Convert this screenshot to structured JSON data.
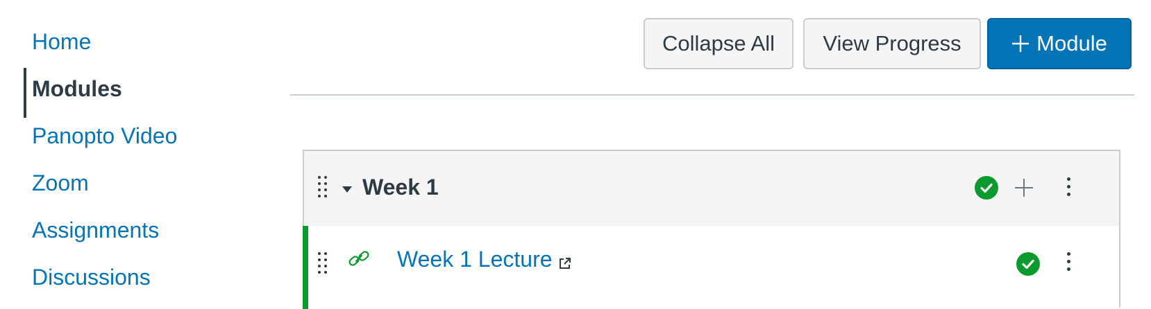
{
  "nav": {
    "items": [
      {
        "label": "Home"
      },
      {
        "label": "Modules"
      },
      {
        "label": "Panopto Video"
      },
      {
        "label": "Zoom"
      },
      {
        "label": "Assignments"
      },
      {
        "label": "Discussions"
      }
    ],
    "active_item": "Modules"
  },
  "header": {
    "collapse_all_label": "Collapse All",
    "view_progress_label": "View Progress",
    "add_module_label": "Module",
    "add_module_icon": "plus-icon"
  },
  "module": {
    "title": "Week 1",
    "status_icon": "check-circle-icon",
    "add_item_icon": "plus-icon",
    "menu_icon": "kebab-icon",
    "items": [
      {
        "title": "Week 1 Lecture",
        "type_icon": "link-icon",
        "external_icon": "external-link-icon",
        "status_icon": "check-circle-icon"
      }
    ]
  },
  "colors": {
    "link": "#0374b5",
    "text": "#2d3b45",
    "primary_button": "#0374b5",
    "published_green": "#0b9a2e",
    "border": "#c7cdd1",
    "header_bg": "#f5f5f5"
  }
}
